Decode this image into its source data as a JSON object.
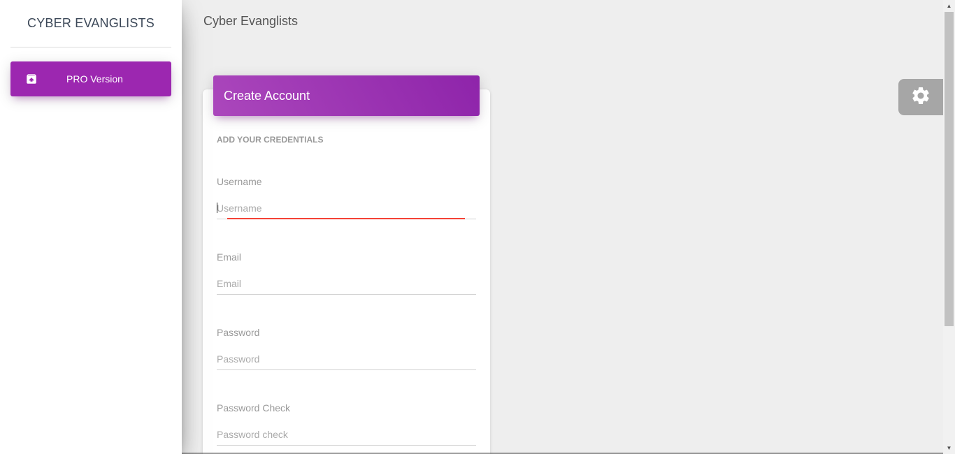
{
  "sidebar": {
    "brand": "CYBER EVANGLISTS",
    "items": [
      {
        "label": "PRO Version",
        "icon": "unarchive-icon",
        "active": true
      }
    ]
  },
  "topbar": {
    "title": "Cyber Evanglists"
  },
  "card": {
    "title": "Create Account",
    "section_title": "ADD YOUR CREDENTIALS",
    "fields": [
      {
        "label": "Username",
        "placeholder": "Username",
        "value": ""
      },
      {
        "label": "Email",
        "placeholder": "Email",
        "value": ""
      },
      {
        "label": "Password",
        "placeholder": "Password",
        "value": ""
      },
      {
        "label": "Password Check",
        "placeholder": "Password check",
        "value": ""
      }
    ]
  },
  "fixed_plugin": {
    "icon": "gear-icon"
  },
  "colors": {
    "primary": "#9c27b0",
    "focus_underline": "#f44336",
    "background": "#eeeeee"
  }
}
